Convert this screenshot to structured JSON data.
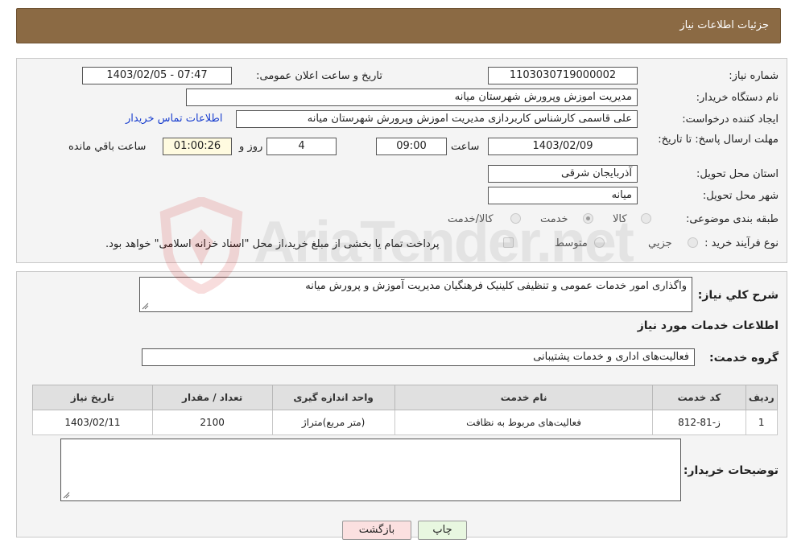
{
  "header": {
    "title": "جزئیات اطلاعات نیاز"
  },
  "form": {
    "need_number_label": "شماره نیاز:",
    "need_number": "1103030719000002",
    "announce_label": "تاریخ و ساعت اعلان عمومی:",
    "announce_value": "1403/02/05 - 07:47",
    "buyer_org_label": "نام دستگاه خریدار:",
    "buyer_org": "مدیریت اموزش وپرورش شهرستان میانه",
    "creator_label": "ایجاد کننده درخواست:",
    "creator": "علی قاسمی کارشناس کاربردازی مدیریت اموزش وپرورش شهرستان میانه",
    "contact_link": "اطلاعات تماس خریدار",
    "deadline_label": "مهلت ارسال پاسخ: تا تاریخ:",
    "deadline_date": "1403/02/09",
    "time_label": "ساعت",
    "deadline_time": "09:00",
    "days_value": "4",
    "days_label": "روز و",
    "remaining_time": "01:00:26",
    "remaining_label": "ساعت باقي مانده",
    "province_label": "استان محل تحویل:",
    "province": "آذربایجان شرقی",
    "city_label": "شهر محل تحویل:",
    "city": "میانه",
    "category_label": "طبقه بندی موضوعی:",
    "category_options": [
      "کالا",
      "خدمت",
      "کالا/خدمت"
    ],
    "process_label": "نوع فرآیند خرید :",
    "process_options": [
      "جزیي",
      "متوسط"
    ],
    "payment_note": "پرداخت تمام یا بخشی از مبلغ خرید،از محل \"اسناد خزانه اسلامی\" خواهد بود."
  },
  "description": {
    "label": "شرح کلي نیاز:",
    "text": "واگذاری امور خدمات عمومی و تنظیفی کلینیک فرهنگیان مدیریت آموزش و پرورش میانه"
  },
  "services": {
    "section_title": "اطلاعات خدمات مورد نیاز",
    "group_label": "گروه خدمت:",
    "group_value": "فعالیت‌های اداری و خدمات پشتیبانی",
    "columns": [
      "ردیف",
      "کد خدمت",
      "نام خدمت",
      "واحد اندازه گیری",
      "تعداد / مقدار",
      "تاریخ نیاز"
    ],
    "rows": [
      {
        "row": "1",
        "code": "ز-81-812",
        "name": "فعالیت‌های مربوط به نظافت",
        "unit": "(متر مربع)متراژ",
        "qty": "2100",
        "date": "1403/02/11"
      }
    ]
  },
  "notes": {
    "label": "توضیحات خریدار:"
  },
  "buttons": {
    "print": "چاپ",
    "back": "بازگشت"
  },
  "watermark": {
    "text": "AriaTender.net"
  }
}
